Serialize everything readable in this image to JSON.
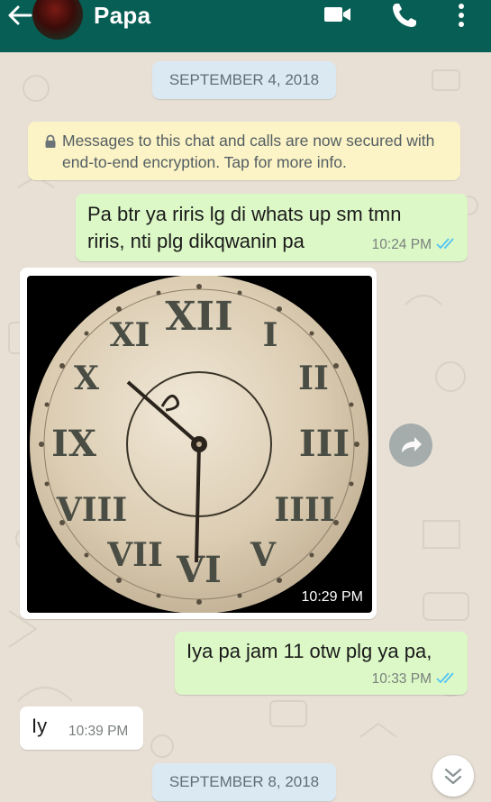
{
  "header": {
    "contact_name": "Papa",
    "icons": [
      "back-arrow-icon",
      "video-call-icon",
      "voice-call-icon",
      "overflow-menu-icon"
    ],
    "bar_color": "#075e54"
  },
  "chat": {
    "date_1": "SEPTEMBER 4, 2018",
    "encryption_notice": "Messages to this chat and calls are now secured with end-to-end encryption. Tap for more info.",
    "messages": [
      {
        "direction": "outgoing",
        "line1": "Pa btr ya riris lg di whats up sm tmn",
        "line2": "riris, nti plg dikqwanin pa",
        "time": "10:24 PM",
        "status": "read"
      },
      {
        "direction": "incoming",
        "type": "image",
        "image_subject": "clock",
        "time": "10:29 PM"
      },
      {
        "direction": "outgoing",
        "text": "Iya pa jam 11 otw plg ya pa,",
        "time": "10:33 PM",
        "status": "read"
      },
      {
        "direction": "incoming",
        "text": "Iy",
        "time": "10:39 PM"
      }
    ],
    "date_2": "SEPTEMBER 8, 2018"
  },
  "colors": {
    "outgoing_bubble": "#dcf8c6",
    "incoming_bubble": "#ffffff",
    "read_ticks": "#4fc3f7",
    "date_pill": "#dbe9f3",
    "notice": "#fcf3c6"
  }
}
